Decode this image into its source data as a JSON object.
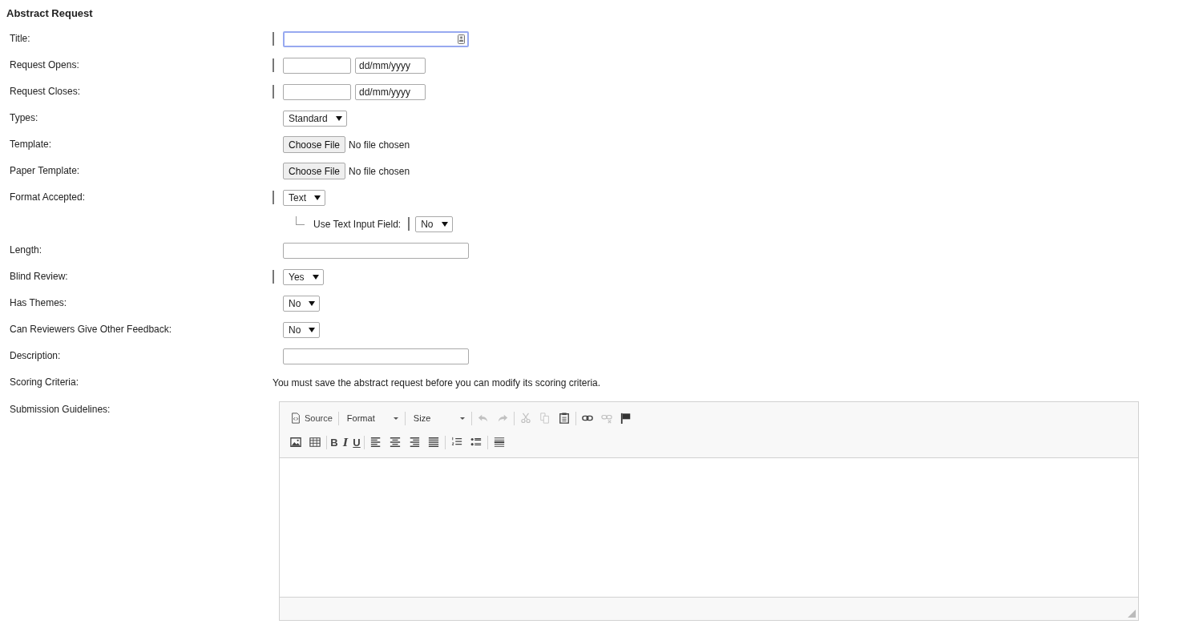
{
  "heading": "Abstract Request",
  "rows": [
    {
      "label": "Title:",
      "kind": "text",
      "required": true,
      "focused": true
    },
    {
      "label": "Request Opens:",
      "kind": "date",
      "required": true,
      "placeholder": "dd/mm/yyyy"
    },
    {
      "label": "Request Closes:",
      "kind": "date",
      "required": true,
      "placeholder": "dd/mm/yyyy"
    },
    {
      "label": "Types:",
      "kind": "select",
      "required": false,
      "value": "Standard"
    },
    {
      "label": "Template:",
      "kind": "file",
      "required": false,
      "button": "Choose File",
      "status": "No file chosen"
    },
    {
      "label": "Paper Template:",
      "kind": "file",
      "required": false,
      "button": "Choose File",
      "status": "No file chosen"
    },
    {
      "label": "Format Accepted:",
      "kind": "select",
      "required": true,
      "value": "Text",
      "children": [
        {
          "label": "Use Text Input Field:",
          "kind": "select",
          "required": true,
          "value": "No"
        }
      ]
    },
    {
      "label": "Length:",
      "kind": "text",
      "required": false,
      "focused": false
    },
    {
      "label": "Blind Review:",
      "kind": "select",
      "required": true,
      "value": "Yes"
    },
    {
      "label": "Has Themes:",
      "kind": "select",
      "required": false,
      "value": "No"
    },
    {
      "label": "Can Reviewers Give Other Feedback:",
      "kind": "select",
      "required": false,
      "value": "No"
    },
    {
      "label": "Description:",
      "kind": "text",
      "required": false,
      "focused": false
    },
    {
      "label": "Scoring Criteria:",
      "kind": "note",
      "text": "You must save the abstract request before you can modify its scoring criteria."
    },
    {
      "label": "Submission Guidelines:",
      "kind": "editor",
      "toolbar": [
        [
          {
            "kind": "source",
            "label": "Source",
            "disabled": false
          },
          {
            "kind": "sep"
          },
          {
            "kind": "combo",
            "label": "Format"
          },
          {
            "kind": "sep"
          },
          {
            "kind": "combo",
            "label": "Size"
          },
          {
            "kind": "sep"
          },
          {
            "kind": "undo",
            "disabled": true
          },
          {
            "kind": "redo",
            "disabled": true
          },
          {
            "kind": "sep"
          },
          {
            "kind": "cut",
            "disabled": true
          },
          {
            "kind": "copy",
            "disabled": true
          },
          {
            "kind": "paste",
            "disabled": false
          },
          {
            "kind": "sep"
          },
          {
            "kind": "link",
            "disabled": false
          },
          {
            "kind": "unlink",
            "disabled": true
          },
          {
            "kind": "flag",
            "disabled": false
          }
        ],
        [
          {
            "kind": "image",
            "disabled": false
          },
          {
            "kind": "table",
            "disabled": false
          },
          {
            "kind": "sep"
          },
          {
            "kind": "bold",
            "label": "B",
            "disabled": false
          },
          {
            "kind": "italic",
            "label": "I",
            "disabled": false
          },
          {
            "kind": "underline",
            "label": "U",
            "disabled": false
          },
          {
            "kind": "sep"
          },
          {
            "kind": "left",
            "disabled": false
          },
          {
            "kind": "center",
            "disabled": false
          },
          {
            "kind": "right",
            "disabled": false
          },
          {
            "kind": "justify",
            "disabled": false
          },
          {
            "kind": "sep"
          },
          {
            "kind": "ol",
            "disabled": false
          },
          {
            "kind": "ul",
            "disabled": false
          },
          {
            "kind": "sep"
          },
          {
            "kind": "hr",
            "disabled": false
          }
        ]
      ]
    }
  ]
}
